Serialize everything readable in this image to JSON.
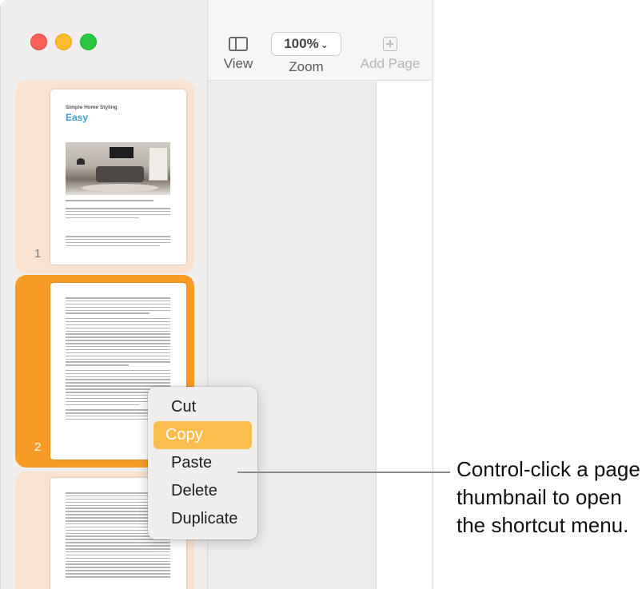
{
  "toolbar": {
    "view_label": "View",
    "zoom_value": "100%",
    "zoom_label": "Zoom",
    "add_page_label": "Add Page"
  },
  "sidebar": {
    "pages": [
      {
        "number": "1",
        "kicker": "Simple Home Styling",
        "title": "Easy",
        "selected": false
      },
      {
        "number": "2",
        "selected": true
      },
      {
        "number": "",
        "selected": false
      }
    ]
  },
  "context_menu": {
    "items": [
      {
        "label": "Cut",
        "selected": false
      },
      {
        "label": "Copy",
        "selected": true
      },
      {
        "label": "Paste",
        "selected": false
      },
      {
        "label": "Delete",
        "selected": false
      },
      {
        "label": "Duplicate",
        "selected": false
      }
    ]
  },
  "callout": {
    "text": "Control-click a page thumbnail to open the shortcut menu."
  },
  "colors": {
    "selected_thumb": "#f89b24",
    "unselected_thumb": "#fbe3cf",
    "menu_highlight": "#fbbe4e",
    "title_accent": "#3d9ad6"
  }
}
